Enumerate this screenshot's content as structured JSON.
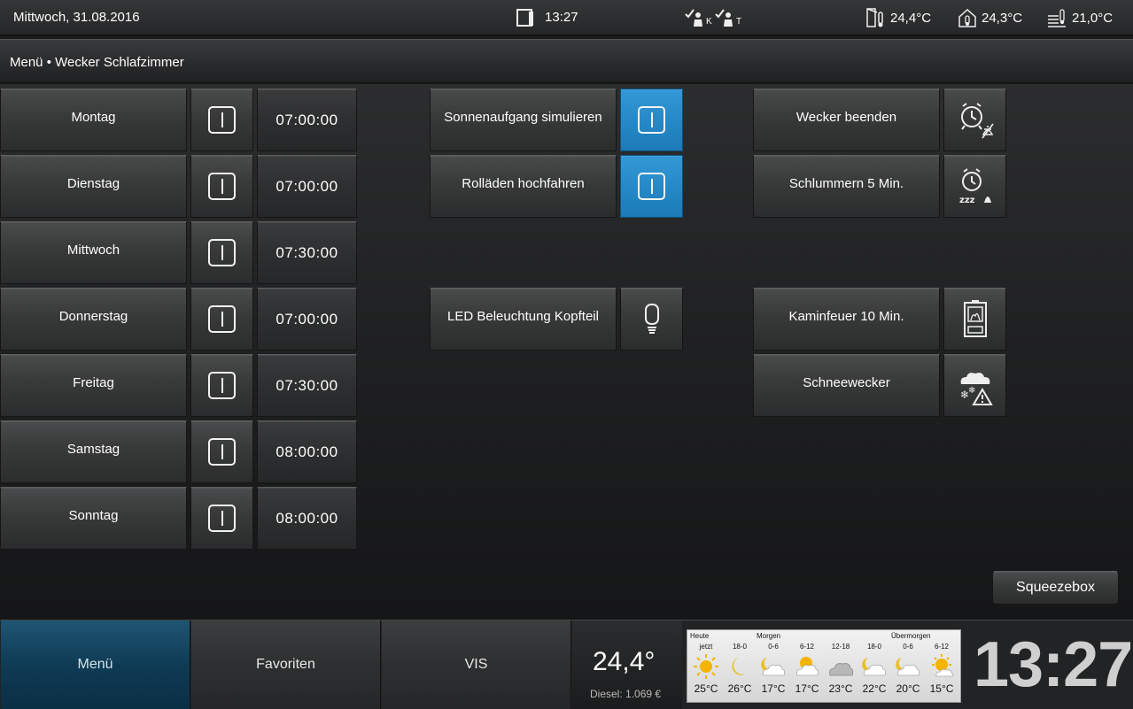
{
  "topbar": {
    "date": "Mittwoch, 31.08.2016",
    "time": "13:27",
    "presence_k": "K",
    "presence_t": "T",
    "temp_outdoor": "24,4°C",
    "temp_house": "24,3°C",
    "temp_heating": "21,0°C"
  },
  "breadcrumb": "Menü • Wecker Schlafzimmer",
  "days": [
    {
      "label": "Montag",
      "time": "07:00:00"
    },
    {
      "label": "Dienstag",
      "time": "07:00:00"
    },
    {
      "label": "Mittwoch",
      "time": "07:30:00"
    },
    {
      "label": "Donnerstag",
      "time": "07:00:00"
    },
    {
      "label": "Freitag",
      "time": "07:30:00"
    },
    {
      "label": "Samstag",
      "time": "08:00:00"
    },
    {
      "label": "Sonntag",
      "time": "08:00:00"
    }
  ],
  "middle": {
    "sunrise": "Sonnenaufgang simulieren",
    "shutters": "Rolläden hochfahren",
    "led": "LED Beleuchtung Kopfteil"
  },
  "right": {
    "stop_alarm": "Wecker beenden",
    "snooze": "Schlummern 5 Min.",
    "fireplace": "Kaminfeuer 10 Min.",
    "snow_alarm": "Schneewecker"
  },
  "squeezebox": "Squeezebox",
  "nav": {
    "menu": "Menü",
    "favorites": "Favoriten",
    "vis": "VIS"
  },
  "fuel": {
    "temp": "24,4°",
    "diesel": "Diesel: 1.069 €"
  },
  "weather": {
    "heute": "Heute",
    "morgen": "Morgen",
    "uebermorgen": "Übermorgen",
    "columns": [
      {
        "period": "jetzt",
        "icon": "sun-icon",
        "temp": "25°C"
      },
      {
        "period": "18-0",
        "icon": "moon-icon",
        "temp": "26°C"
      },
      {
        "period": "0-6",
        "icon": "cloud-moon-icon",
        "temp": "17°C"
      },
      {
        "period": "6-12",
        "icon": "cloud-sun-icon",
        "temp": "17°C"
      },
      {
        "period": "12-18",
        "icon": "cloud-icon",
        "temp": "23°C"
      },
      {
        "period": "18-0",
        "icon": "cloud-moon-icon",
        "temp": "22°C"
      },
      {
        "period": "0-6",
        "icon": "cloud-moon-icon",
        "temp": "20°C"
      },
      {
        "period": "6-12",
        "icon": "sun-cloud-icon",
        "temp": "15°C"
      }
    ]
  },
  "bigclock": "13:27"
}
